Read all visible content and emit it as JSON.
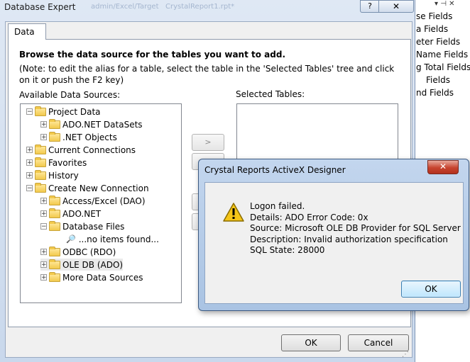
{
  "database_expert": {
    "title": "Database Expert",
    "faded_title_text_1": "admin/Excel/Target",
    "faded_title_text_2": "CrystalReport1.rpt*",
    "help_label": "?",
    "close_label": "✕",
    "tab_label": "Data",
    "heading": "Browse the data source for the tables you want to add.",
    "note": "(Note: to edit the alias for a table, select the table in the 'Selected Tables' tree and click on it or push the F2 key)",
    "available_label": "Available Data Sources:",
    "selected_label": "Selected Tables:",
    "tree": [
      {
        "label": "Project Data",
        "expander": "−"
      },
      {
        "label": "ADO.NET DataSets",
        "expander": "+"
      },
      {
        "label": ".NET Objects",
        "expander": "+"
      },
      {
        "label": "Current Connections",
        "expander": "+"
      },
      {
        "label": "Favorites",
        "expander": "+"
      },
      {
        "label": "History",
        "expander": "+"
      },
      {
        "label": "Create New Connection",
        "expander": "−"
      },
      {
        "label": "Access/Excel (DAO)",
        "expander": "+"
      },
      {
        "label": "ADO.NET",
        "expander": "+"
      },
      {
        "label": "Database Files",
        "expander": "−"
      },
      {
        "label": "...no items found..."
      },
      {
        "label": "ODBC (RDO)",
        "expander": "+"
      },
      {
        "label": "OLE DB (ADO)",
        "expander": "+"
      },
      {
        "label": "More Data Sources",
        "expander": "+"
      }
    ],
    "add_button": ">",
    "ok_label": "OK",
    "cancel_label": "Cancel"
  },
  "field_explorer": {
    "pin": "▾ ⊣ ✕",
    "items": [
      "se Fields",
      "a Fields",
      "eter Fields",
      "Name Fields",
      "g Total Fields",
      "Fields",
      "nd Fields"
    ]
  },
  "dialog": {
    "title": "Crystal Reports ActiveX Designer",
    "close_label": "✕",
    "lines": [
      "Logon failed.",
      "Details: ADO Error Code: 0x",
      "Source: Microsoft OLE DB Provider for SQL Server",
      "Description: Invalid authorization specification",
      "SQL State: 28000"
    ],
    "ok_label": "OK"
  },
  "colors": {
    "window_frame": "#c9d8ec",
    "dialog_frame": "#a9c3e3",
    "close_red": "#c7432e",
    "warning_yellow": "#f5c518"
  }
}
